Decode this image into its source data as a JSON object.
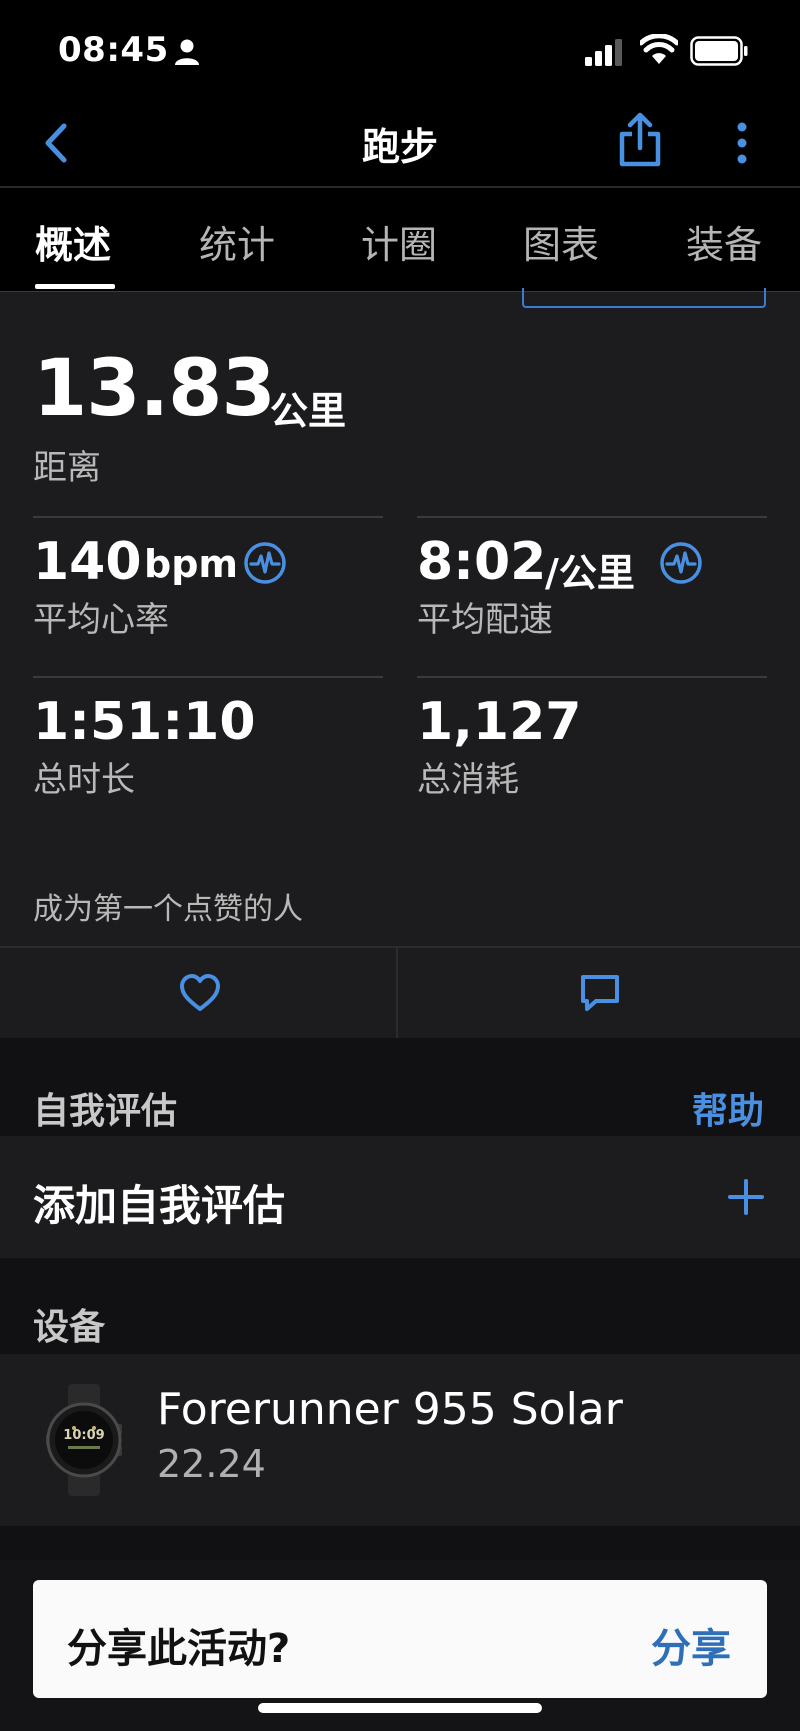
{
  "status_bar": {
    "time": "08:45"
  },
  "nav": {
    "title": "跑步"
  },
  "tabs": [
    {
      "label": "概述",
      "active": true
    },
    {
      "label": "统计",
      "active": false
    },
    {
      "label": "计圈",
      "active": false
    },
    {
      "label": "图表",
      "active": false
    },
    {
      "label": "装备",
      "active": false
    }
  ],
  "summary": {
    "distance": {
      "value": "13.83",
      "unit": "公里",
      "label": "距离"
    },
    "heart_rate": {
      "value": "140",
      "unit": "bpm",
      "label": "平均心率"
    },
    "pace": {
      "value": "8:02",
      "unit": "/公里",
      "label": "平均配速"
    },
    "duration": {
      "value": "1:51:10",
      "label": "总时长"
    },
    "calories": {
      "value": "1,127",
      "label": "总消耗"
    },
    "like_prompt": "成为第一个点赞的人"
  },
  "self_assessment": {
    "section_title": "自我评估",
    "help_label": "帮助",
    "add_label": "添加自我评估"
  },
  "device": {
    "section_title": "设备",
    "name": "Forerunner 955 Solar",
    "version": "22.24"
  },
  "share_prompt": {
    "question": "分享此活动?",
    "button_label": "分享"
  },
  "colors": {
    "accent": "#4a90e2",
    "card_background": "#1c1c1e",
    "page_background": "#000000"
  }
}
